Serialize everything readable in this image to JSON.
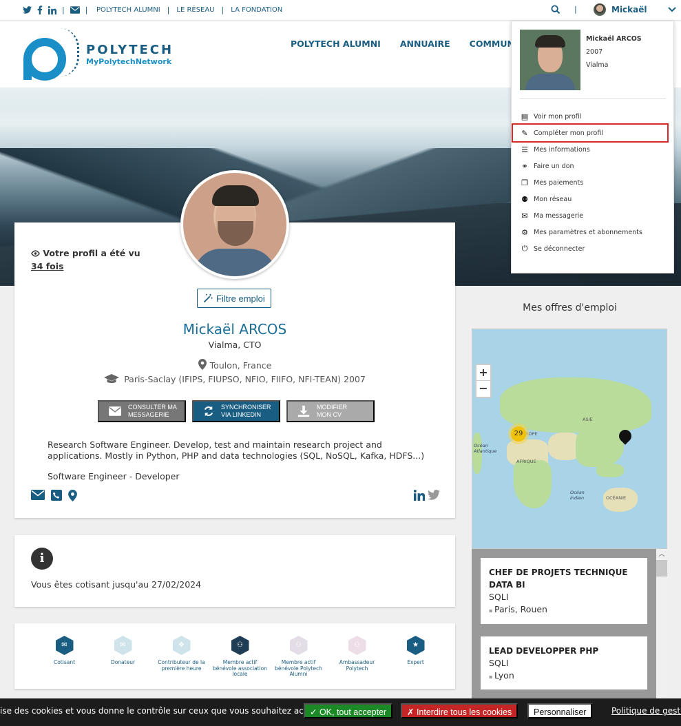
{
  "topbar": {
    "links": [
      "POLYTECH ALUMNI",
      "LE RÉSEAU",
      "LA FONDATION"
    ],
    "user_name": "Mickaël"
  },
  "logo": {
    "title": "POLYTECH",
    "subtitle": "MyPolytechNetwork"
  },
  "mainnav": {
    "items": [
      "POLYTECH ALUMNI",
      "ANNUAIRE",
      "COMMUNICA"
    ]
  },
  "profile": {
    "viewed_label": "Votre profil a été vu",
    "viewed_count": "34 fois",
    "filter_button": "Filtre emploi",
    "name": "Mickaël ARCOS",
    "job": "Vialma, CTO",
    "location": "Toulon, France",
    "school": "Paris-Saclay (IFIPS, FIUPSO, NFIO, FIIFO, NFI-TEAN) 2007",
    "actions": [
      {
        "line1": "CONSULTER MA",
        "line2": "MESSAGERIE"
      },
      {
        "line1": "SYNCHRONISER",
        "line2": "VIA LINKEDIN"
      },
      {
        "line1": "MODIFIER",
        "line2": "MON CV"
      }
    ],
    "bio": "Research Software Engineer. Develop, test and maintain research project and applications. Mostly in Python, PHP and data technologies (SQL, NoSQL, Kafka, HDFS...)",
    "headline": "Software Engineer - Developer"
  },
  "membership": {
    "text": "Vous êtes cotisant jusqu'au 27/02/2024"
  },
  "badges": [
    {
      "label": "Cotisant",
      "active": true
    },
    {
      "label": "Donateur",
      "active": false
    },
    {
      "label": "Contributeur de la première heure",
      "active": false
    },
    {
      "label": "Membre actif bénévole association locale",
      "active": true
    },
    {
      "label": "Membre actif bénévole Polytech Alumni",
      "active": false
    },
    {
      "label": "Ambassadeur Polytech",
      "active": false
    },
    {
      "label": "Expert",
      "active": true
    }
  ],
  "jobs": {
    "title": "Mes offres d'emploi",
    "cluster_count": "29",
    "map_labels": [
      "ASIE",
      "EUROPE",
      "AFRIQUE",
      "Océan Atlantique",
      "Océan Indien",
      "OCÉANIE"
    ],
    "items": [
      {
        "title": "CHEF DE PROJETS TECHNIQUE DATA BI",
        "company": "SQLI",
        "location": "Paris, Rouen"
      },
      {
        "title": "LEAD DEVELOPPER PHP",
        "company": "SQLI",
        "location": "Lyon"
      }
    ]
  },
  "dropdown": {
    "name": "Mickaël ARCOS",
    "year": "2007",
    "company": "Vialma",
    "items": [
      {
        "label": "Voir mon profil",
        "icon": "id-card-icon"
      },
      {
        "label": "Compléter mon profil",
        "icon": "edit-icon"
      },
      {
        "label": "Mes informations",
        "icon": "list-icon"
      },
      {
        "label": "Faire un don",
        "icon": "handshake-icon"
      },
      {
        "label": "Mes paiements",
        "icon": "copy-icon"
      },
      {
        "label": "Mon réseau",
        "icon": "users-icon"
      },
      {
        "label": "Ma messagerie",
        "icon": "envelope-icon"
      },
      {
        "label": "Mes paramètres et abonnements",
        "icon": "gear-icon"
      },
      {
        "label": "Se déconnecter",
        "icon": "power-icon"
      }
    ]
  },
  "cookie": {
    "message": "ise des cookies et vous donne le contrôle sur ceux que vous souhaitez activer",
    "accept": "✓ OK, tout accepter",
    "deny": "✗ Interdire tous les cookies",
    "customize": "Personnaliser",
    "policy": "Politique de gestio"
  },
  "colors": {
    "brand": "#1a5d82",
    "accent": "#1a8fc7",
    "accept": "#1b8a26",
    "deny": "#c52525"
  }
}
